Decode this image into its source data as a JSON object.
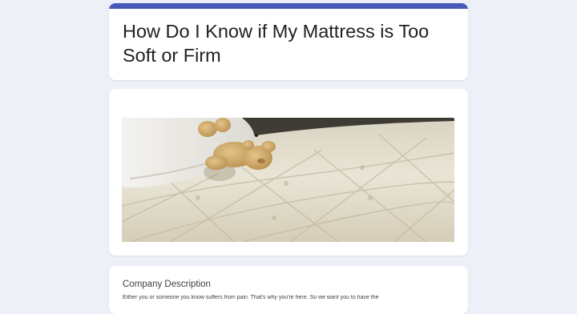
{
  "form": {
    "title": "How Do I Know if My Mattress is Too Soft or Firm",
    "accent_color": "#4758b8"
  },
  "image": {
    "subject": "teddy-bear-on-mattress-photo"
  },
  "description": {
    "label": "Company Description",
    "text": "Either you or someone you know suffers from pain. That's why you're here. So we want you to have the"
  }
}
